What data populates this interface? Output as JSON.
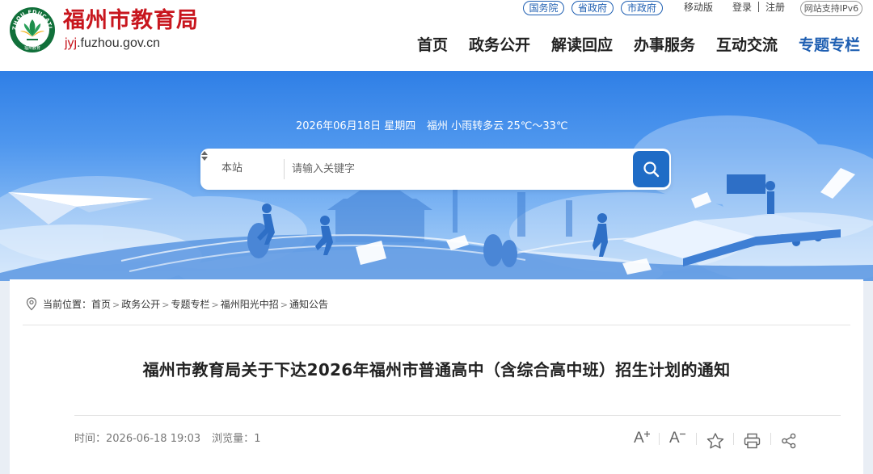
{
  "header": {
    "site_name": "福州市教育局",
    "site_domain_prefix": "jyj",
    "site_domain_rest": ".fuzhou.gov.cn",
    "emblem_text": "FUZHOU EDUCATION",
    "emblem_caption": "福州教育",
    "top_links": {
      "state_council": "国务院",
      "provincial_gov": "省政府",
      "city_gov": "市政府",
      "mobile": "移动版",
      "login": "登录",
      "register": "注册",
      "ipv6": "网站支持IPv6"
    },
    "nav": [
      "首页",
      "政务公开",
      "解读回应",
      "办事服务",
      "互动交流",
      "专题专栏"
    ],
    "active_nav": "专题专栏"
  },
  "banner": {
    "date": "2026年06月18日 星期四",
    "weather": "福州 小雨转多云 25℃～33℃"
  },
  "search": {
    "scope": "本站",
    "placeholder": "请输入关键字",
    "search_icon": "search-icon"
  },
  "breadcrumb": {
    "prefix": "当前位置：",
    "items": [
      "首页",
      "政务公开",
      "专题专栏",
      "福州阳光中招",
      "通知公告"
    ],
    "icon": "location-pin-icon"
  },
  "article": {
    "title": "福州市教育局关于下达2026年福州市普通高中（含综合高中班）招生计划的通知",
    "time_label": "时间：",
    "time_value": "2026-06-18 19:03",
    "views_label": "浏览量：",
    "views_value": "1"
  },
  "tools": {
    "font_larger_label": "A",
    "font_smaller_label": "A",
    "icons": [
      "font-larger-icon",
      "font-smaller-icon",
      "favorite-star-icon",
      "print-icon",
      "share-icon"
    ]
  },
  "colors": {
    "brand_red": "#c8161e",
    "brand_blue": "#1f5fb2",
    "search_button": "#1f6cc6",
    "banner_sky": "#2f7fe6"
  }
}
